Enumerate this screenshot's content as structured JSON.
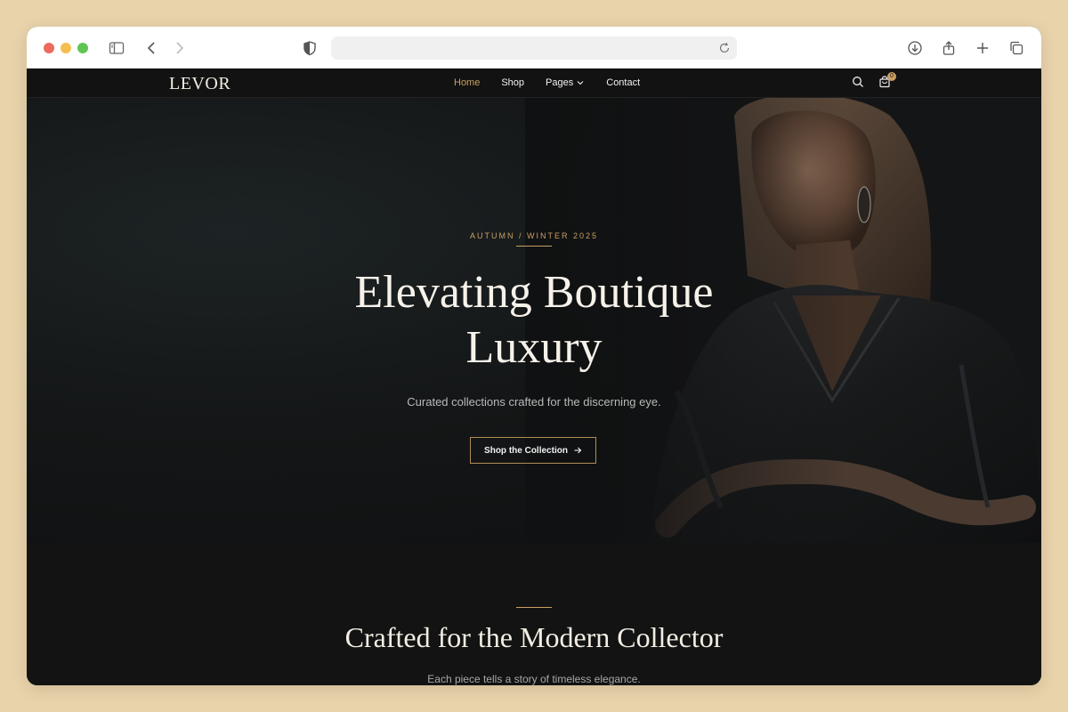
{
  "browser": {
    "url": "",
    "icons": [
      "sidebar-icon",
      "back-icon",
      "forward-icon",
      "shield-icon",
      "reload-icon",
      "download-icon",
      "share-icon",
      "new-tab-icon",
      "tabs-icon"
    ]
  },
  "header": {
    "logo": "LEVOR",
    "nav": [
      {
        "label": "Home",
        "active": true
      },
      {
        "label": "Shop",
        "active": false
      },
      {
        "label": "Pages",
        "active": false
      },
      {
        "label": "Contact",
        "active": false
      }
    ],
    "cart_count": "0"
  },
  "hero": {
    "eyebrow": "AUTUMN / WINTER 2025",
    "title_line1": "Elevating Boutique",
    "title_line2": "Luxury",
    "subtitle": "Curated collections crafted for the discerning eye.",
    "cta_label": "Shop the Collection"
  },
  "section": {
    "title": "Crafted for the Modern Collector",
    "subtitle": "Each piece tells a story of timeless elegance."
  },
  "colors": {
    "accent": "#c9a063",
    "background": "#131313",
    "page_bg": "#e9d3ab"
  }
}
